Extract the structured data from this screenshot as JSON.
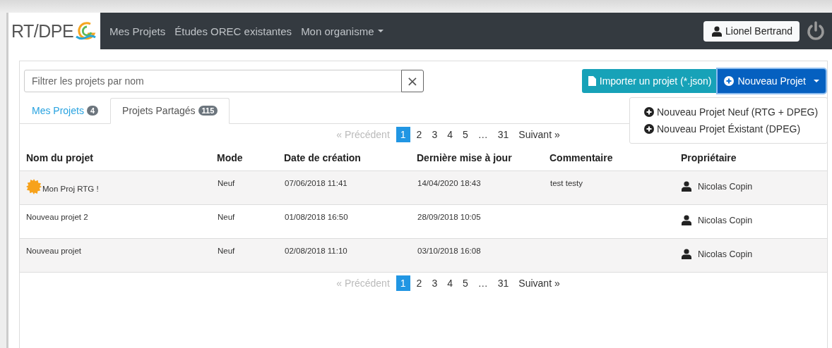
{
  "navbar": {
    "logo": "RT/DPE",
    "links": [
      {
        "label": "Mes Projets",
        "dropdown": false
      },
      {
        "label": "Études OREC existantes",
        "dropdown": false
      },
      {
        "label": "Mon organisme",
        "dropdown": true
      }
    ],
    "user": "Lionel Bertrand"
  },
  "toolbar": {
    "filter": {
      "placeholder": "Filtrer les projets par nom"
    },
    "clear": "×",
    "import_button": "Importer un projet (*.json)",
    "new_button": "Nouveau Projet",
    "menu_open": true,
    "menu_items": [
      "Nouveau Projet Neuf (RTG + DPEG)",
      "Nouveau Projet Éxistant (DPEG)"
    ]
  },
  "tabs": [
    {
      "label": "Mes Projets",
      "count": "4",
      "selected": false
    },
    {
      "label": "Projets Partagés",
      "count": "115",
      "selected": true
    }
  ],
  "pagination_top": {
    "previous": {
      "label": "Précédent",
      "arrow": "«",
      "disabled": true
    },
    "pages": [
      {
        "label": "1",
        "selected": true
      },
      {
        "label": "2",
        "selected": false
      },
      {
        "label": "3",
        "selected": false
      },
      {
        "label": "4",
        "selected": false
      },
      {
        "label": "5",
        "selected": false
      },
      {
        "label": "…",
        "selected": false
      },
      {
        "label": "31",
        "selected": false
      }
    ],
    "next": {
      "label": "Suivant",
      "arrow": "»",
      "disabled": false
    }
  },
  "table": {
    "columns": [
      "Nom du projet",
      "Mode",
      "Date de création",
      "Dernière mise à jour",
      "Commentaire",
      "Propriétaire"
    ],
    "rows": [
      {
        "name": "Mon Proj RTG !",
        "kind": "sun",
        "mode": "Neuf",
        "created": "07/06/2018 11:41",
        "updated": "14/04/2020 18:43",
        "comment": "test testy",
        "owner": "Nicolas Copin"
      },
      {
        "name": "Nouveau projet 2",
        "kind": "plain",
        "mode": "Neuf",
        "created": "01/08/2018 16:50",
        "updated": "28/09/2018 10:05",
        "owner": "Nicolas Copin"
      },
      {
        "name": "Nouveau projet",
        "kind": "plain",
        "mode": "Neuf",
        "created": "02/08/2018 11:10",
        "updated": "03/10/2018 16:08",
        "owner": "Nicolas Copin"
      }
    ]
  },
  "pagination_bottom": {
    "previous": {
      "label": "Précédent",
      "arrow": "«",
      "disabled": true
    },
    "pages": [
      {
        "label": "1",
        "selected": true
      },
      {
        "label": "2",
        "selected": false
      },
      {
        "label": "3",
        "selected": false
      },
      {
        "label": "4",
        "selected": false
      },
      {
        "label": "5",
        "selected": false
      },
      {
        "label": "…",
        "selected": false
      },
      {
        "label": "31",
        "selected": false
      }
    ],
    "next": {
      "label": "Suivant",
      "arrow": "»",
      "disabled": false
    }
  }
}
